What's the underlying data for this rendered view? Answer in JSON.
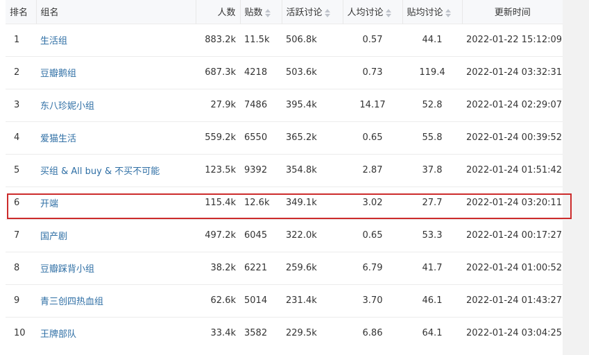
{
  "headers": {
    "rank": "排名",
    "group": "组名",
    "members": "人数",
    "posts": "贴数",
    "active": "活跃讨论",
    "per_member": "人均讨论",
    "per_post": "贴均讨论",
    "updated": "更新时间"
  },
  "rows": [
    {
      "rank": "1",
      "group": "生活组",
      "members": "883.2k",
      "posts": "11.5k",
      "active": "506.8k",
      "per_member": "0.57",
      "per_post": "44.1",
      "updated": "2022-01-22 15:12:09"
    },
    {
      "rank": "2",
      "group": "豆瓣鹅组",
      "members": "687.3k",
      "posts": "4218",
      "active": "503.6k",
      "per_member": "0.73",
      "per_post": "119.4",
      "updated": "2022-01-24 03:32:31"
    },
    {
      "rank": "3",
      "group": "东八珍妮小组",
      "members": "27.9k",
      "posts": "7486",
      "active": "395.4k",
      "per_member": "14.17",
      "per_post": "52.8",
      "updated": "2022-01-24 02:29:07"
    },
    {
      "rank": "4",
      "group": "爱猫生活",
      "members": "559.2k",
      "posts": "6550",
      "active": "365.2k",
      "per_member": "0.65",
      "per_post": "55.8",
      "updated": "2022-01-24 00:39:52"
    },
    {
      "rank": "5",
      "group": "买组 & All buy & 不买不可能",
      "members": "123.5k",
      "posts": "9392",
      "active": "354.8k",
      "per_member": "2.87",
      "per_post": "37.8",
      "updated": "2022-01-24 01:51:42"
    },
    {
      "rank": "6",
      "group": "开端",
      "members": "115.4k",
      "posts": "12.6k",
      "active": "349.1k",
      "per_member": "3.02",
      "per_post": "27.7",
      "updated": "2022-01-24 03:20:11"
    },
    {
      "rank": "7",
      "group": "国产剧",
      "members": "497.2k",
      "posts": "6045",
      "active": "322.0k",
      "per_member": "0.65",
      "per_post": "53.3",
      "updated": "2022-01-24 00:17:27"
    },
    {
      "rank": "8",
      "group": "豆瓣踩背小组",
      "members": "38.2k",
      "posts": "6221",
      "active": "259.6k",
      "per_member": "6.79",
      "per_post": "41.7",
      "updated": "2022-01-24 01:00:52"
    },
    {
      "rank": "9",
      "group": "青三创四热血组",
      "members": "62.6k",
      "posts": "5014",
      "active": "231.4k",
      "per_member": "3.70",
      "per_post": "46.1",
      "updated": "2022-01-24 01:43:27"
    },
    {
      "rank": "10",
      "group": "王牌部队",
      "members": "33.4k",
      "posts": "3582",
      "active": "229.5k",
      "per_member": "6.86",
      "per_post": "64.1",
      "updated": "2022-01-24 03:04:25"
    }
  ],
  "colors": {
    "link": "#2f6fa5",
    "highlight": "#cc2b2b",
    "header_bg": "#f7f8fa"
  },
  "icons": {
    "sort": "sort-caret-icon"
  }
}
